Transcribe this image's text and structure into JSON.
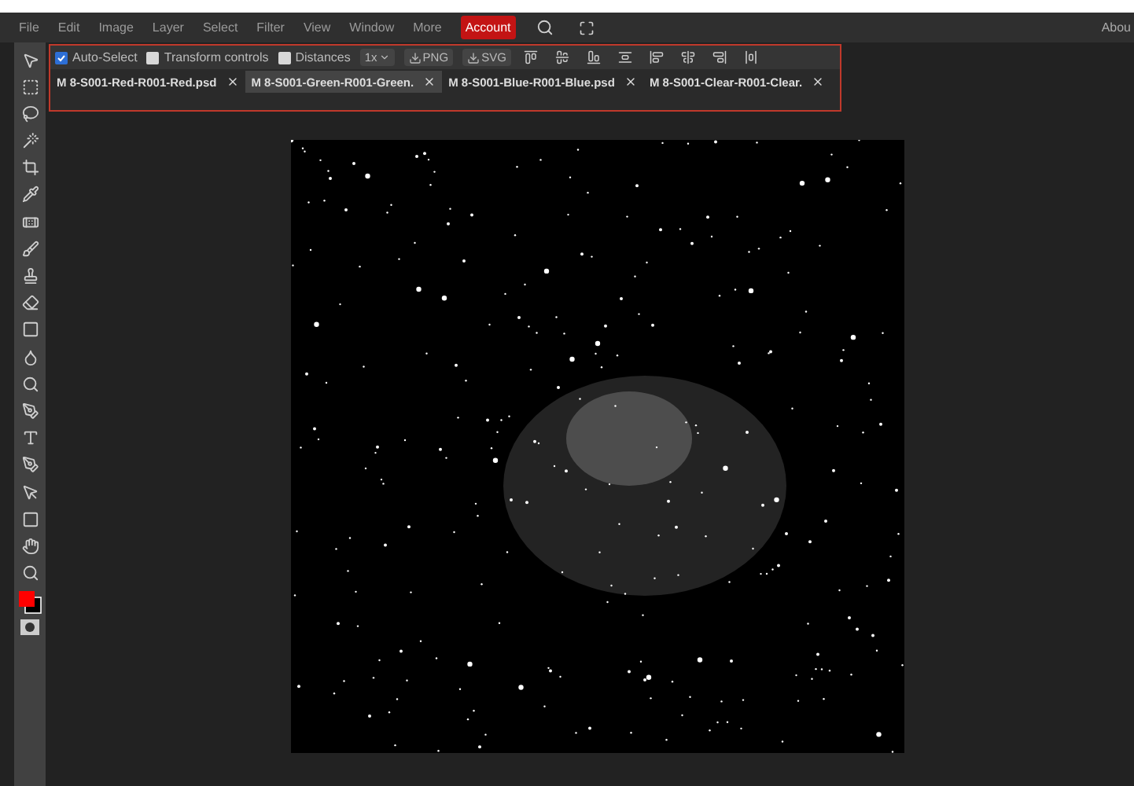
{
  "menu": [
    {
      "label": "File",
      "selected": false
    },
    {
      "label": "Edit",
      "selected": false
    },
    {
      "label": "Image",
      "selected": false
    },
    {
      "label": "Layer",
      "selected": false
    },
    {
      "label": "Select",
      "selected": false
    },
    {
      "label": "Filter",
      "selected": false
    },
    {
      "label": "View",
      "selected": false
    },
    {
      "label": "Window",
      "selected": false
    },
    {
      "label": "More",
      "selected": false
    },
    {
      "label": "Account",
      "selected": true
    }
  ],
  "about_link": "Abou",
  "options": {
    "checks": [
      {
        "label": "Auto-Select",
        "checked": true
      },
      {
        "label": "Transform controls",
        "checked": false
      },
      {
        "label": "Distances",
        "checked": false
      }
    ],
    "zoom_dropdown": "1x",
    "export_buttons": [
      "PNG",
      "SVG"
    ]
  },
  "tabs": [
    {
      "label": "M 8-S001-Red-R001-Red.psd",
      "selected": false
    },
    {
      "label": "M 8-S001-Green-R001-Green.",
      "selected": true
    },
    {
      "label": "M 8-S001-Blue-R001-Blue.psd",
      "selected": false
    },
    {
      "label": "M 8-S001-Clear-R001-Clear.",
      "selected": false
    }
  ]
}
